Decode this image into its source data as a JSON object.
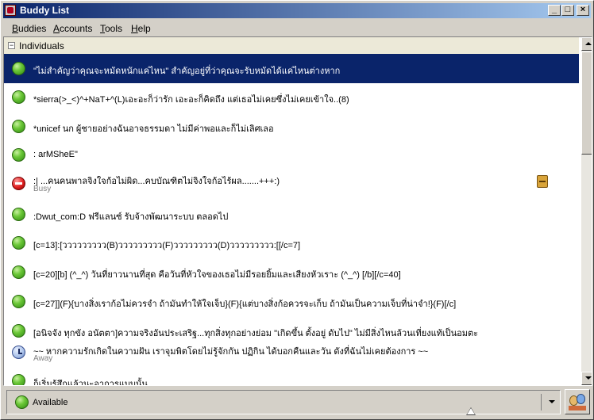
{
  "window": {
    "title": "Buddy List",
    "controls": {
      "minimize": "_",
      "maximize": "□",
      "close": "×"
    }
  },
  "menu": [
    "Buddies",
    "Accounts",
    "Tools",
    "Help"
  ],
  "menu_accel": [
    "B",
    "A",
    "T",
    "H"
  ],
  "menu_rest": [
    "uddies",
    "ccounts",
    "ools",
    "elp"
  ],
  "group": {
    "expander": "−",
    "label": "Individuals"
  },
  "buddies": [
    {
      "name": "\"ไม่สำคัญว่าคุณจะหมัดหนักแค่ไหน\" สำคัญอยู่ที่ว่าคุณจะรับหมัดได้แค่ไหนต่างหาก",
      "status": "available",
      "selected": true
    },
    {
      "name": "*sierra(>_<)^+NaT+^(L)เอะอะก็ว่ารัก เอะอะก็คิดถึง แต่เธอไม่เคยซึ่งไม่เคยเข้าใจ..(8)",
      "status": "available"
    },
    {
      "name": "*unicef นก ผู้ชายอย่างฉันอาจธรรมดา ไม่มีค่าพอและก็ไม่เลิศเลอ",
      "status": "available"
    },
    {
      "name": ": arMSheE\"",
      "status": "available"
    },
    {
      "name": ":| ...คนคนพาลจิงใจก้อไม่ผิด...คบบัณฑิตไม่จิงใจก้อไร้ผล.......+++:)",
      "status": "busy",
      "sub": "Busy",
      "emblem": "note-emblem"
    },
    {
      "name": ":Dwut_com:D ฟรีแลนซ์ รับจ้างพัฒนาระบบ ตลอดไป",
      "status": "available"
    },
    {
      "name": "[c=13]:[ววววววววว(B)ววววววววว(F)ววววววววว(D)ววววววววว:[[/c=7]",
      "status": "available"
    },
    {
      "name": "[c=20][b] (^_^) วันที่ยาวนานที่สุด คือวันที่หัวใจของเธอไม่มีรอยยิ้มและเสียงหัวเราะ (^_^) [/b][/c=40]",
      "status": "available"
    },
    {
      "name": "[c=27]](F){บางสิ่งเราก้อไม่ควรจำ ถ้ามันทำให้ใจเจ็บ}(F){แต่บางสิ่งก้อควรจะเก็บ ถ้ามันเป็นความเจ็บที่น่าจำ!}(F)[/c]",
      "status": "available"
    },
    {
      "name": "[อนิจจัง ทุกขัง อนัตตา]ความจริงอันประเสริฐ...ทุกสิ่งทุกอย่างย่อม \"เกิดขึ้น ตั้งอยู่ ดับไป\" ไม่มีสิ่งไหนล้วนเที่ยงแท้เป็นอมตะ",
      "status": "available"
    },
    {
      "name": "~~ หากความรักเกิดในความฝัน เราจุมพิตโดยไม่รู้จักกัน ปฏิกิน ได้บอกคืนและวัน ดังที่ฉันไม่เคยต้องการ ~~",
      "status": "away",
      "sub": "Away"
    },
    {
      "name": "ก็เริ่มรู้สึกแล้วนะอาการแบบนั้น",
      "status": "available"
    }
  ],
  "status_selector": {
    "label": "Available"
  }
}
